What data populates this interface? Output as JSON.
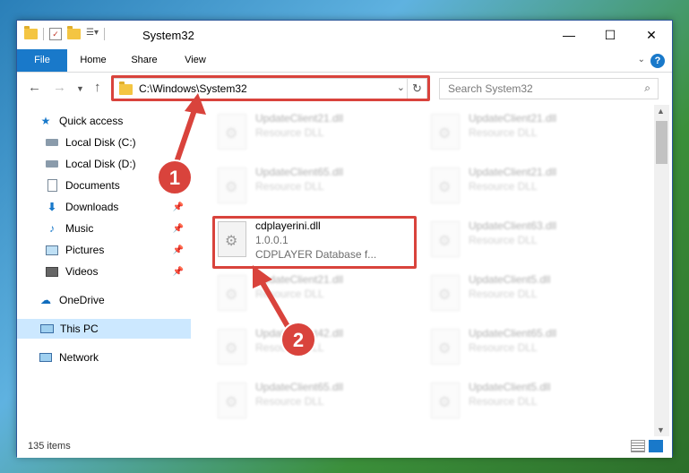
{
  "window": {
    "title": "System32",
    "controls": {
      "minimize": "—",
      "maximize": "☐",
      "close": "✕"
    }
  },
  "ribbon": {
    "tabs": [
      "File",
      "Home",
      "Share",
      "View"
    ],
    "help": "?",
    "expand": "⌄"
  },
  "nav": {
    "address": "C:\\Windows\\System32",
    "search_placeholder": "Search System32"
  },
  "sidebar": {
    "items": [
      {
        "label": "Quick access",
        "icon": "star-icon"
      },
      {
        "label": "Local Disk (C:)",
        "icon": "drive-icon"
      },
      {
        "label": "Local Disk (D:)",
        "icon": "drive-icon"
      },
      {
        "label": "Documents",
        "icon": "document-icon"
      },
      {
        "label": "Downloads",
        "icon": "download-icon"
      },
      {
        "label": "Music",
        "icon": "music-icon"
      },
      {
        "label": "Pictures",
        "icon": "pictures-icon"
      },
      {
        "label": "Videos",
        "icon": "videos-icon"
      },
      {
        "label": "OneDrive",
        "icon": "cloud-icon"
      },
      {
        "label": "This PC",
        "icon": "computer-icon"
      },
      {
        "label": "Network",
        "icon": "network-icon"
      }
    ]
  },
  "files": {
    "left": [
      {
        "name": "UpdateClient21.dll",
        "type": "Resource DLL"
      },
      {
        "name": "UpdateClient65.dll",
        "type": "Resource DLL"
      },
      {
        "name": "cdplayerini.dll",
        "type": "1.0.0.1",
        "desc": "CDPLAYER Database f..."
      },
      {
        "name": "UpdateClient21.dll",
        "type": "Resource DLL"
      },
      {
        "name": "UpdateClient42.dll",
        "type": "Resource DLL"
      },
      {
        "name": "UpdateClient65.dll",
        "type": "Resource DLL"
      }
    ],
    "right": [
      {
        "name": "UpdateClient21.dll",
        "type": "Resource DLL"
      },
      {
        "name": "UpdateClient21.dll",
        "type": "Resource DLL"
      },
      {
        "name": "UpdateClient63.dll",
        "type": "Resource DLL"
      },
      {
        "name": "UpdateClient5.dll",
        "type": "Resource DLL"
      },
      {
        "name": "UpdateClient65.dll",
        "type": "Resource DLL"
      },
      {
        "name": "UpdateClient5.dll",
        "type": "Resource DLL"
      }
    ]
  },
  "status": {
    "count": "135 items"
  },
  "annotations": {
    "step1": "1",
    "step2": "2"
  },
  "colors": {
    "accent": "#1979ca",
    "highlight": "#d9433c",
    "selected": "#cce8ff"
  }
}
